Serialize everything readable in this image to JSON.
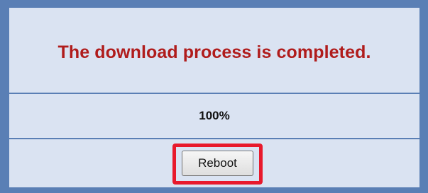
{
  "status": {
    "message": "The download process is completed.",
    "progress_text": "100%",
    "progress_value": 100
  },
  "actions": {
    "reboot_label": "Reboot"
  },
  "colors": {
    "frame": "#5a7fb5",
    "panel": "#dae3f2",
    "message": "#b01c1c",
    "highlight": "#e8192c"
  }
}
